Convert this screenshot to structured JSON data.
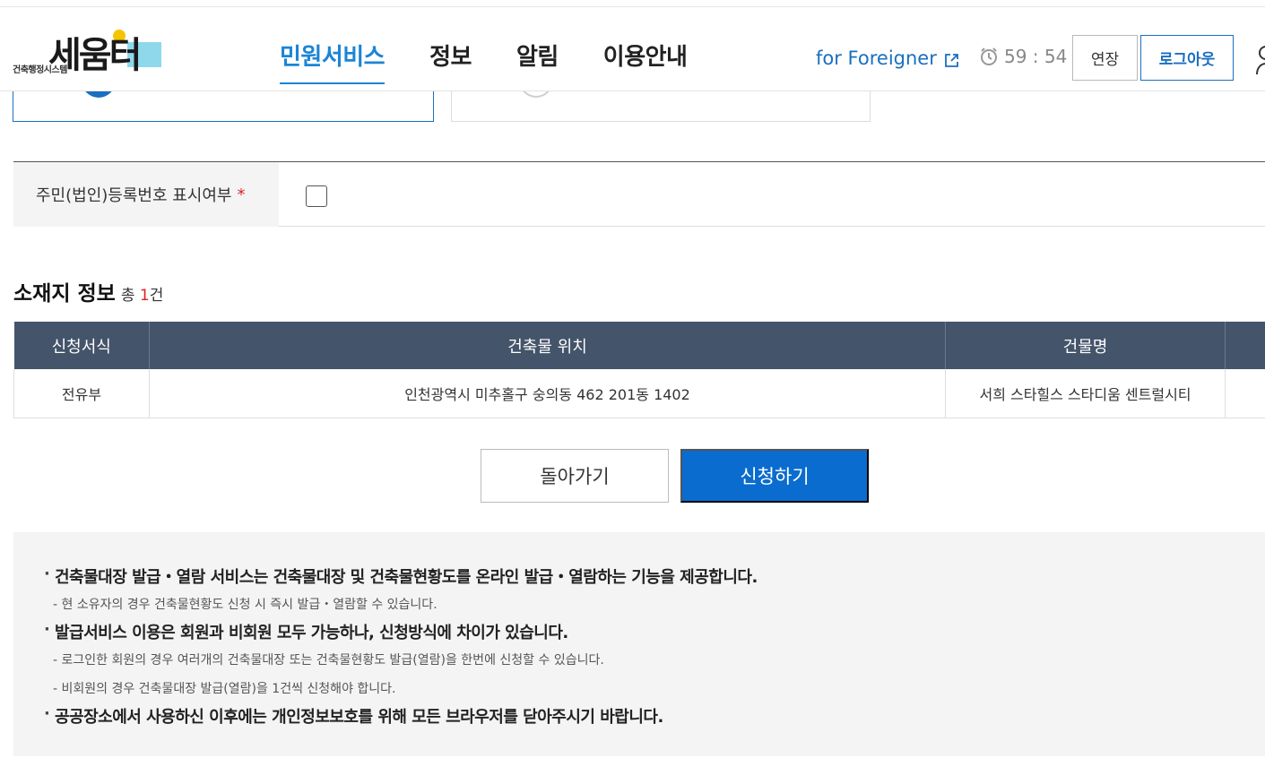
{
  "header": {
    "logo_main": "세움터",
    "logo_sub": "건축행정시스템",
    "nav": [
      "민원서비스",
      "정보",
      "알림",
      "이용안내"
    ],
    "foreigner_label": "for Foreigner",
    "timer": "59 : 54",
    "extend_label": "연장",
    "logout_label": "로그아웃"
  },
  "form": {
    "resident_label": "주민(법인)등록번호 표시여부",
    "required_mark": "*"
  },
  "section": {
    "title": "소재지 정보",
    "count_prefix": "총",
    "count": "1",
    "count_suffix": "건"
  },
  "table": {
    "headers": [
      "신청서식",
      "건축물 위치",
      "건물명",
      ""
    ],
    "rows": [
      [
        "전유부",
        "인천광역시 미추홀구 숭의동 462 201동 1402",
        "서희 스타힐스 스타디움 센트럴시티",
        ""
      ]
    ]
  },
  "buttons": {
    "back": "돌아가기",
    "apply": "신청하기"
  },
  "notice": {
    "items": [
      {
        "type": "main",
        "text": "건축물대장 발급・열람 서비스는 건축물대장 및 건축물현황도를 온라인 발급・열람하는 기능을 제공합니다."
      },
      {
        "type": "sub",
        "text": "- 현 소유자의 경우 건축물현황도 신청 시 즉시 발급・열람할 수 있습니다."
      },
      {
        "type": "main",
        "text": "발급서비스 이용은 회원과 비회원 모두 가능하나, 신청방식에 차이가 있습니다."
      },
      {
        "type": "sub",
        "text": "- 로그인한 회원의 경우 여러개의 건축물대장 또는 건축물현황도 발급(열람)을 한번에 신청할 수 있습니다."
      },
      {
        "type": "sub",
        "text": "- 비회원의 경우 건축물대장 발급(열람)을 1건씩 신청해야 합니다."
      },
      {
        "type": "main",
        "text": "공공장소에서 사용하신 이후에는 개인정보보호를 위해 모든 브라우저를 닫아주시기 바랍니다."
      }
    ]
  },
  "colors": {
    "primary": "#0a6cce",
    "nav_active": "#1a85d6",
    "table_header": "#44546a",
    "required": "#e02020"
  }
}
